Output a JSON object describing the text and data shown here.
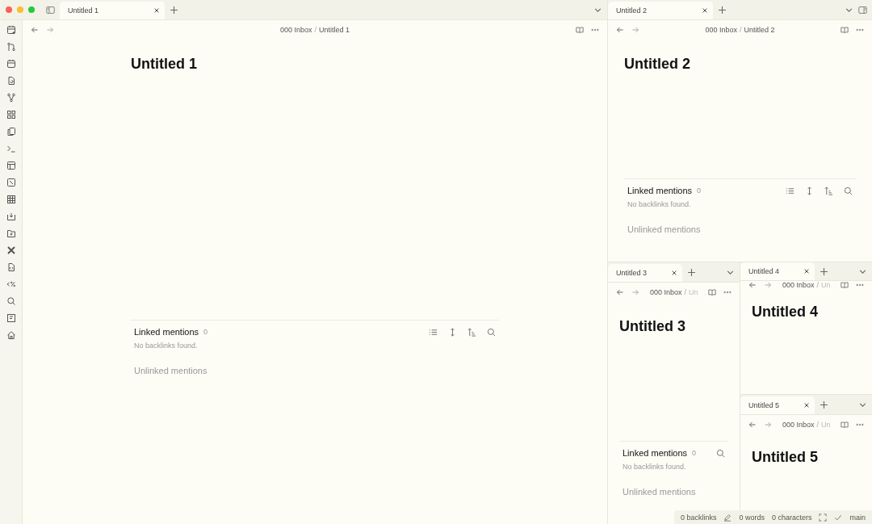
{
  "panes": [
    {
      "tabs": [
        {
          "label": "Untitled 1",
          "selected": true
        }
      ],
      "breadcrumb": {
        "folder": "000 Inbox",
        "separator": "/",
        "note": "Untitled 1"
      },
      "title": "Untitled 1",
      "backlinks": {
        "linked_title": "Linked mentions",
        "count": "0",
        "empty_message": "No backlinks found.",
        "unlinked_title": "Unlinked mentions"
      }
    },
    {
      "tabs": [
        {
          "label": "Untitled 2",
          "selected": true
        }
      ],
      "breadcrumb": {
        "folder": "000 Inbox",
        "separator": "/",
        "note": "Untitled 2"
      },
      "title": "Untitled 2",
      "backlinks": {
        "linked_title": "Linked mentions",
        "count": "0",
        "empty_message": "No backlinks found.",
        "unlinked_title": "Unlinked mentions"
      }
    },
    {
      "tabs": [
        {
          "label": "Untitled 3",
          "selected": true
        }
      ],
      "breadcrumb": {
        "folder": "000 Inbox",
        "separator": "/",
        "note": "Un"
      },
      "title": "Untitled 3",
      "backlinks": {
        "linked_title": "Linked mentions",
        "count": "0",
        "empty_message": "No backlinks found.",
        "unlinked_title": "Unlinked mentions"
      }
    },
    {
      "tabs": [
        {
          "label": "Untitled 4",
          "selected": true
        }
      ],
      "breadcrumb": {
        "folder": "000 Inbox",
        "separator": "/",
        "note": "Un"
      },
      "title": "Untitled 4"
    },
    {
      "tabs": [
        {
          "label": "Untitled 5",
          "selected": true
        }
      ],
      "breadcrumb": {
        "folder": "000 Inbox",
        "separator": "/",
        "note": "Un"
      },
      "title": "Untitled 5"
    }
  ],
  "status_bar": {
    "backlinks": "0 backlinks",
    "words": "0 words",
    "characters": "0 characters",
    "branch": "main"
  }
}
